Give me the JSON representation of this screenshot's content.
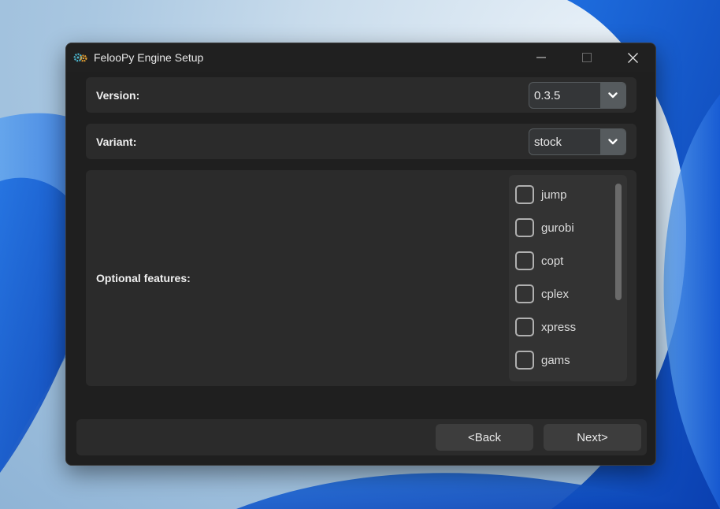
{
  "window": {
    "title": "FelooPy Engine Setup",
    "icon": "gears-icon",
    "controls": [
      "minimize-icon",
      "maximize-icon",
      "close-icon"
    ]
  },
  "form": {
    "version": {
      "label": "Version:",
      "selected": "0.3.5"
    },
    "variant": {
      "label": "Variant:",
      "selected": "stock"
    },
    "optional_features": {
      "label": "Optional features:",
      "items": [
        {
          "label": "jump",
          "checked": false
        },
        {
          "label": "gurobi",
          "checked": false
        },
        {
          "label": "copt",
          "checked": false
        },
        {
          "label": "cplex",
          "checked": false
        },
        {
          "label": "xpress",
          "checked": false
        },
        {
          "label": "gams",
          "checked": false
        }
      ]
    }
  },
  "footer": {
    "back_label": "<Back",
    "next_label": "Next>"
  },
  "colors": {
    "window_bg": "#1f1f1f",
    "panel_bg": "#2b2b2b",
    "select_arrow_bg": "#565b5e",
    "button_bg": "#3d3d3d",
    "text": "#f0f0f0",
    "icon_accent_teal": "#4ab0c8",
    "icon_accent_orange": "#e8a030"
  }
}
